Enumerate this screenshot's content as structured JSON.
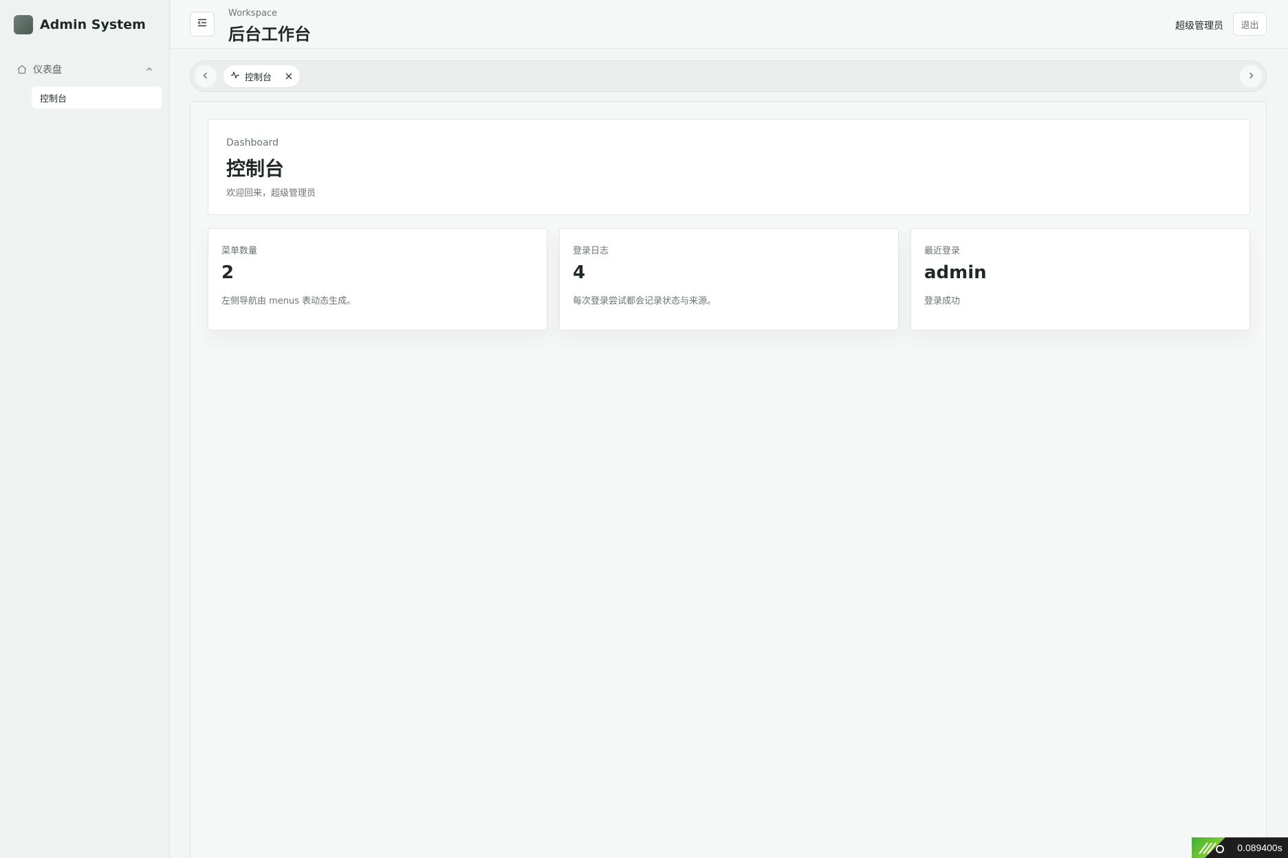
{
  "brand": {
    "name": "Admin System"
  },
  "sidebar": {
    "group": {
      "label": "仪表盘",
      "icon": "home-icon",
      "expanded": true
    },
    "items": [
      {
        "label": "控制台",
        "active": true
      }
    ]
  },
  "header": {
    "subtitle": "Workspace",
    "title": "后台工作台",
    "user": "超级管理员",
    "logout_label": "退出"
  },
  "tabs": [
    {
      "label": "控制台",
      "icon": "activity-icon",
      "closable": true
    }
  ],
  "dashboard": {
    "subtitle": "Dashboard",
    "title": "控制台",
    "welcome": "欢迎回来，超级管理员"
  },
  "stats": [
    {
      "label": "菜单数量",
      "value": "2",
      "description": "左侧导航由 menus 表动态生成。"
    },
    {
      "label": "登录日志",
      "value": "4",
      "description": "每次登录尝试都会记录状态与来源。"
    },
    {
      "label": "最近登录",
      "value": "admin",
      "description": "登录成功"
    }
  ],
  "timer": {
    "value": "0.089400s"
  },
  "colors": {
    "accent": "#4c5a54",
    "background": "#f3f6f5",
    "card": "#ffffff"
  }
}
